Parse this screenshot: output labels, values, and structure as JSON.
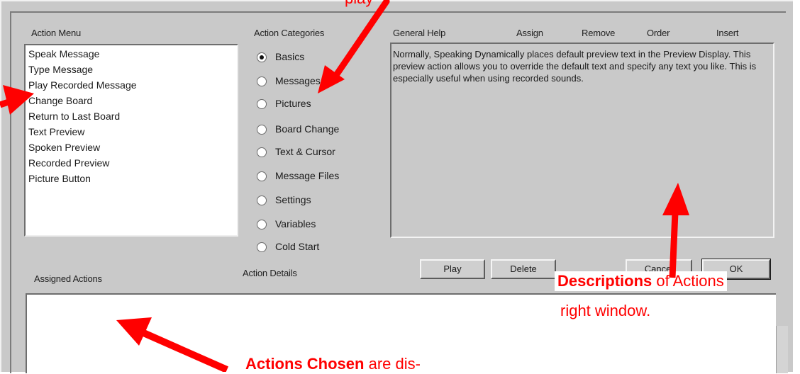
{
  "labels": {
    "action_menu": "Action Menu",
    "action_categories": "Action Categories",
    "general_help": "General Help",
    "assign": "Assign",
    "remove": "Remove",
    "order": "Order",
    "insert": "Insert",
    "assigned_actions": "Assigned Actions",
    "action_details": "Action Details"
  },
  "action_menu_items": [
    "Speak Message",
    "Type Message",
    "Play Recorded Message",
    "Change Board",
    "Return to Last Board",
    "Text Preview",
    "Spoken Preview",
    "Recorded Preview",
    "Picture Button"
  ],
  "categories": [
    {
      "label": "Basics",
      "checked": true
    },
    {
      "label": "Messages",
      "checked": false
    },
    {
      "label": "Pictures",
      "checked": false
    },
    {
      "label": "Board Change",
      "checked": false
    },
    {
      "label": "Text & Cursor",
      "checked": false
    },
    {
      "label": "Message Files",
      "checked": false
    },
    {
      "label": "Settings",
      "checked": false
    },
    {
      "label": "Variables",
      "checked": false
    },
    {
      "label": "Cold Start",
      "checked": false
    }
  ],
  "help_text": "Normally, Speaking Dynamically places default preview text in the Preview Display. This preview action allows you to override the default text and specify any text you like. This is especially useful when using recorded sounds.",
  "buttons": {
    "play": "Play",
    "delete": "Delete",
    "cancel": "Cancel",
    "ok": "OK"
  },
  "annotations": {
    "descriptions_bold": "Descriptions",
    "descriptions_rest": " of Actions",
    "descriptions_line2": "right window.",
    "chosen_bold": "Actions Chosen",
    "chosen_rest": " are dis-",
    "top_fragment": "play",
    "color": "#ff0000"
  }
}
